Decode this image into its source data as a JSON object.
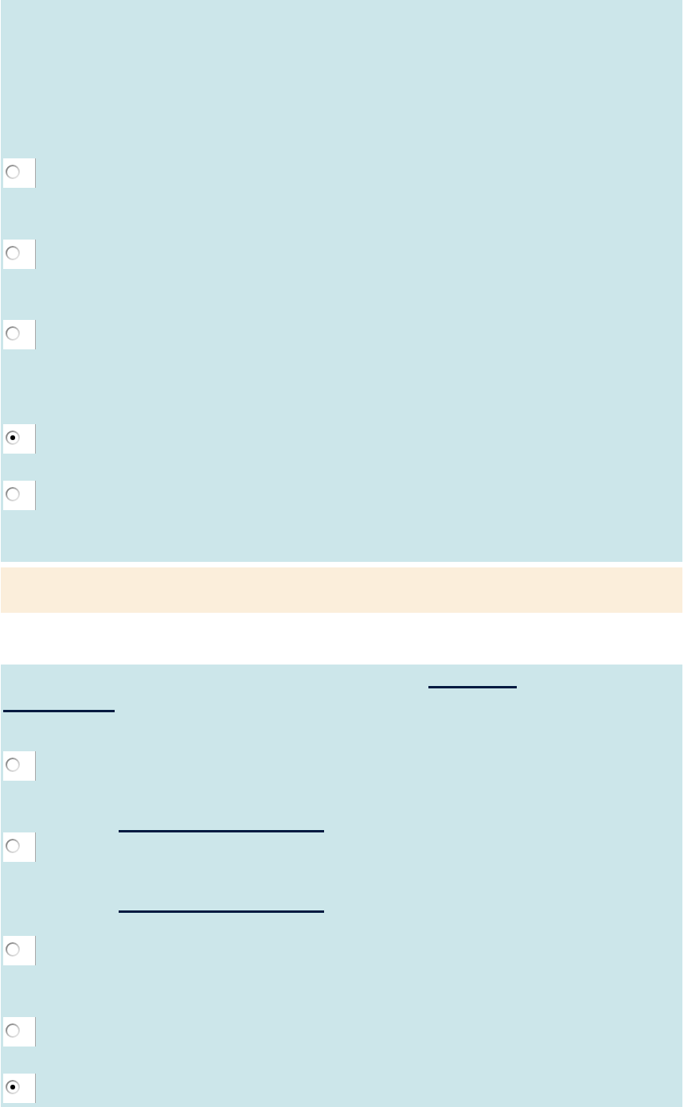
{
  "sections": [
    {
      "kind": "question",
      "prompt_link": false,
      "options": [
        {
          "selected": false,
          "underlined": false
        },
        {
          "selected": false,
          "underlined": false
        },
        {
          "selected": false,
          "underlined": false
        },
        {
          "selected": true,
          "underlined": false
        },
        {
          "selected": false,
          "underlined": false
        }
      ]
    },
    {
      "kind": "notice"
    },
    {
      "kind": "question",
      "prompt_link": true,
      "options": [
        {
          "selected": false,
          "underlined": false
        },
        {
          "selected": false,
          "underlined": true
        },
        {
          "selected": false,
          "underlined": true
        },
        {
          "selected": false,
          "underlined": false
        },
        {
          "selected": true,
          "underlined": false
        }
      ]
    }
  ]
}
